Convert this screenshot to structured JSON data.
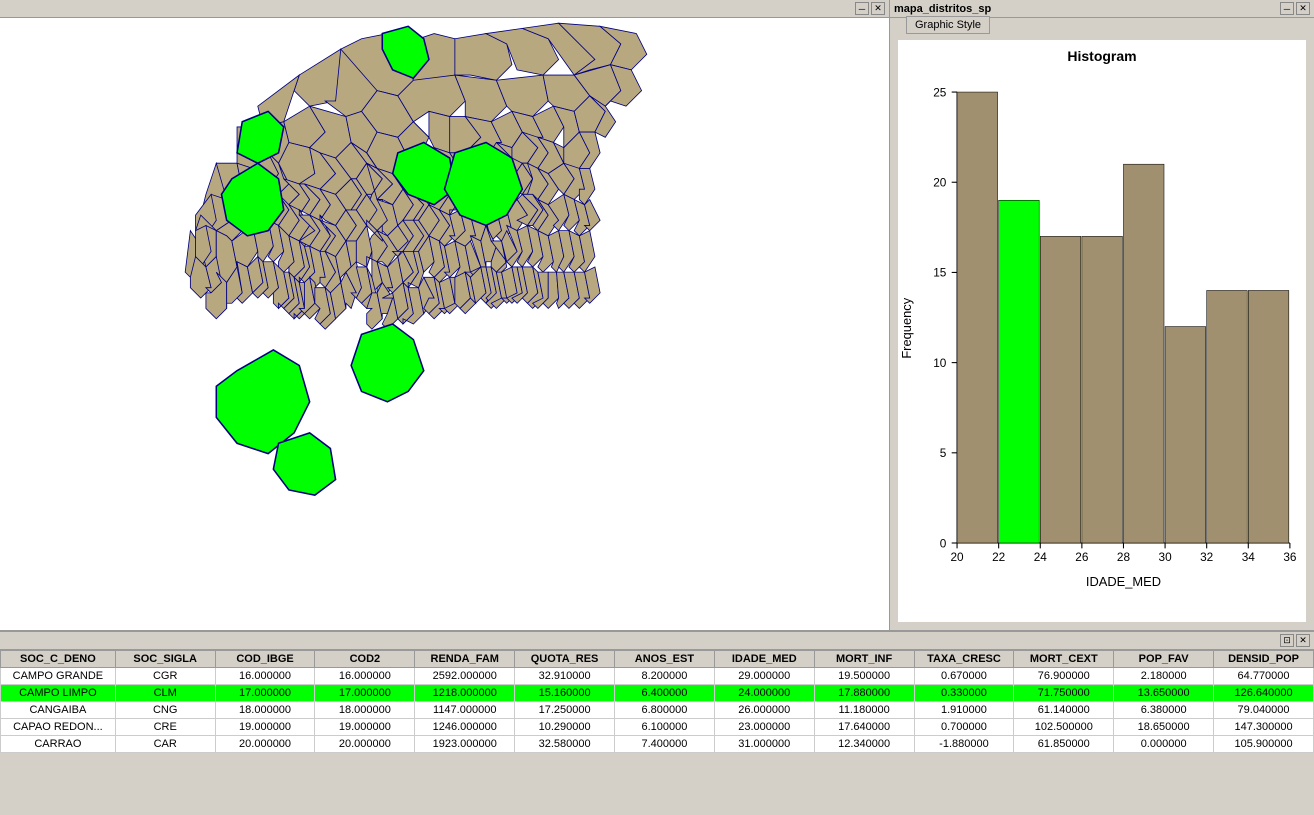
{
  "map_panel": {
    "titlebar_minimize": "─",
    "titlebar_close": "✕"
  },
  "chart_panel": {
    "title": "mapa_distritos_sp",
    "titlebar_minimize": "─",
    "titlebar_close": "✕",
    "graphic_style_btn": "Graphic Style"
  },
  "histogram": {
    "title": "Histogram",
    "x_label": "IDADE_MED",
    "y_label": "Frequency",
    "x_ticks": [
      20,
      22,
      24,
      26,
      28,
      30,
      32,
      34,
      36
    ],
    "y_ticks": [
      0,
      5,
      10,
      15,
      20,
      25
    ],
    "bars": [
      {
        "x_start": 20,
        "x_end": 22,
        "height": 25,
        "highlighted": false
      },
      {
        "x_start": 22,
        "x_end": 24,
        "height": 19,
        "highlighted": true
      },
      {
        "x_start": 24,
        "x_end": 26,
        "height": 17,
        "highlighted": false
      },
      {
        "x_start": 26,
        "x_end": 28,
        "height": 17,
        "highlighted": false
      },
      {
        "x_start": 28,
        "x_end": 30,
        "height": 21,
        "highlighted": false
      },
      {
        "x_start": 30,
        "x_end": 32,
        "height": 12,
        "highlighted": false
      },
      {
        "x_start": 32,
        "x_end": 34,
        "height": 14,
        "highlighted": false
      },
      {
        "x_start": 34,
        "x_end": 36,
        "height": 14,
        "highlighted": false
      }
    ],
    "bar_color": "#a09070",
    "highlight_color": "#00ff00",
    "max_y": 25
  },
  "table": {
    "titlebar_resize": "⊡",
    "titlebar_close": "✕",
    "columns": [
      "SOC_C_DENO",
      "SOC_SIGLA",
      "COD_IBGE",
      "COD2",
      "RENDA_FAM",
      "QUOTA_RES",
      "ANOS_EST",
      "IDADE_MED",
      "MORT_INF",
      "TAXA_CRESC",
      "MORT_CEXT",
      "POP_FAV",
      "DENSID_POP"
    ],
    "rows": [
      {
        "highlighted": false,
        "cells": [
          "CAMPO GRANDE",
          "CGR",
          "16.000000",
          "16.000000",
          "2592.000000",
          "32.910000",
          "8.200000",
          "29.000000",
          "19.500000",
          "0.670000",
          "76.900000",
          "2.180000",
          "64.770000"
        ]
      },
      {
        "highlighted": true,
        "cells": [
          "CAMPO LIMPO",
          "CLM",
          "17.000000",
          "17.000000",
          "1218.000000",
          "15.160000",
          "6.400000",
          "24.000000",
          "17.880000",
          "0.330000",
          "71.750000",
          "13.650000",
          "126.640000"
        ]
      },
      {
        "highlighted": false,
        "cells": [
          "CANGAIBA",
          "CNG",
          "18.000000",
          "18.000000",
          "1147.000000",
          "17.250000",
          "6.800000",
          "26.000000",
          "11.180000",
          "1.910000",
          "61.140000",
          "6.380000",
          "79.040000"
        ]
      },
      {
        "highlighted": false,
        "cells": [
          "CAPAO REDON...",
          "CRE",
          "19.000000",
          "19.000000",
          "1246.000000",
          "10.290000",
          "6.100000",
          "23.000000",
          "17.640000",
          "0.700000",
          "102.500000",
          "18.650000",
          "147.300000"
        ]
      },
      {
        "highlighted": false,
        "cells": [
          "CARRAO",
          "CAR",
          "20.000000",
          "20.000000",
          "1923.000000",
          "32.580000",
          "7.400000",
          "31.000000",
          "12.340000",
          "-1.880000",
          "61.850000",
          "0.000000",
          "105.900000"
        ]
      }
    ]
  }
}
